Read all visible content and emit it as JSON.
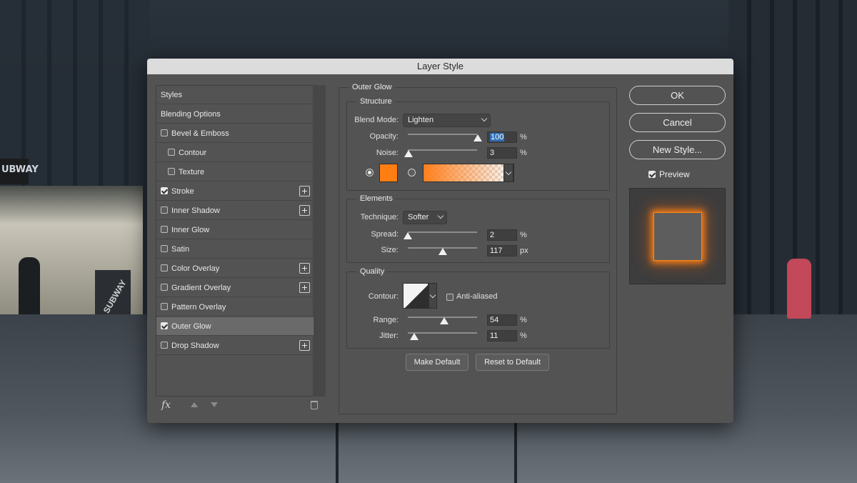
{
  "window": {
    "title": "Layer Style"
  },
  "styles_list": {
    "header": "Styles",
    "items": [
      {
        "label": "Blending Options",
        "checkbox": false
      },
      {
        "label": "Bevel & Emboss",
        "checkbox": true,
        "checked": false
      },
      {
        "label": "Contour",
        "checkbox": true,
        "checked": false,
        "indent": true
      },
      {
        "label": "Texture",
        "checkbox": true,
        "checked": false,
        "indent": true
      },
      {
        "label": "Stroke",
        "checkbox": true,
        "checked": true,
        "plus": true
      },
      {
        "label": "Inner Shadow",
        "checkbox": true,
        "checked": false,
        "plus": true
      },
      {
        "label": "Inner Glow",
        "checkbox": true,
        "checked": false
      },
      {
        "label": "Satin",
        "checkbox": true,
        "checked": false
      },
      {
        "label": "Color Overlay",
        "checkbox": true,
        "checked": false,
        "plus": true
      },
      {
        "label": "Gradient Overlay",
        "checkbox": true,
        "checked": false,
        "plus": true
      },
      {
        "label": "Pattern Overlay",
        "checkbox": true,
        "checked": false
      },
      {
        "label": "Outer Glow",
        "checkbox": true,
        "checked": true,
        "active": true
      },
      {
        "label": "Drop Shadow",
        "checkbox": true,
        "checked": false,
        "plus": true
      }
    ],
    "toolbar": {
      "fx_label": "fx",
      "icons": [
        "fx-icon",
        "move-up-icon",
        "move-down-icon",
        "trash-icon"
      ]
    }
  },
  "outer_glow": {
    "title": "Outer Glow",
    "structure": {
      "title": "Structure",
      "blend_mode_label": "Blend Mode:",
      "blend_mode_value": "Lighten",
      "opacity_label": "Opacity:",
      "opacity_value": "100",
      "opacity_unit": "%",
      "noise_label": "Noise:",
      "noise_value": "3",
      "noise_unit": "%",
      "color_mode": "solid",
      "glow_color": "#ff7e14"
    },
    "elements": {
      "title": "Elements",
      "technique_label": "Technique:",
      "technique_value": "Softer",
      "spread_label": "Spread:",
      "spread_value": "2",
      "spread_unit": "%",
      "size_label": "Size:",
      "size_value": "117",
      "size_unit": "px"
    },
    "quality": {
      "title": "Quality",
      "contour_label": "Contour:",
      "anti_aliased_label": "Anti-aliased",
      "anti_aliased": false,
      "range_label": "Range:",
      "range_value": "54",
      "range_unit": "%",
      "jitter_label": "Jitter:",
      "jitter_value": "11",
      "jitter_unit": "%"
    },
    "buttons": {
      "make_default": "Make Default",
      "reset_default": "Reset to Default"
    }
  },
  "actions": {
    "ok": "OK",
    "cancel": "Cancel",
    "new_style": "New Style...",
    "preview_label": "Preview",
    "preview_checked": true
  },
  "background_signs": {
    "store_sign": "UBWAY",
    "box_sign": "SUBWAY"
  }
}
